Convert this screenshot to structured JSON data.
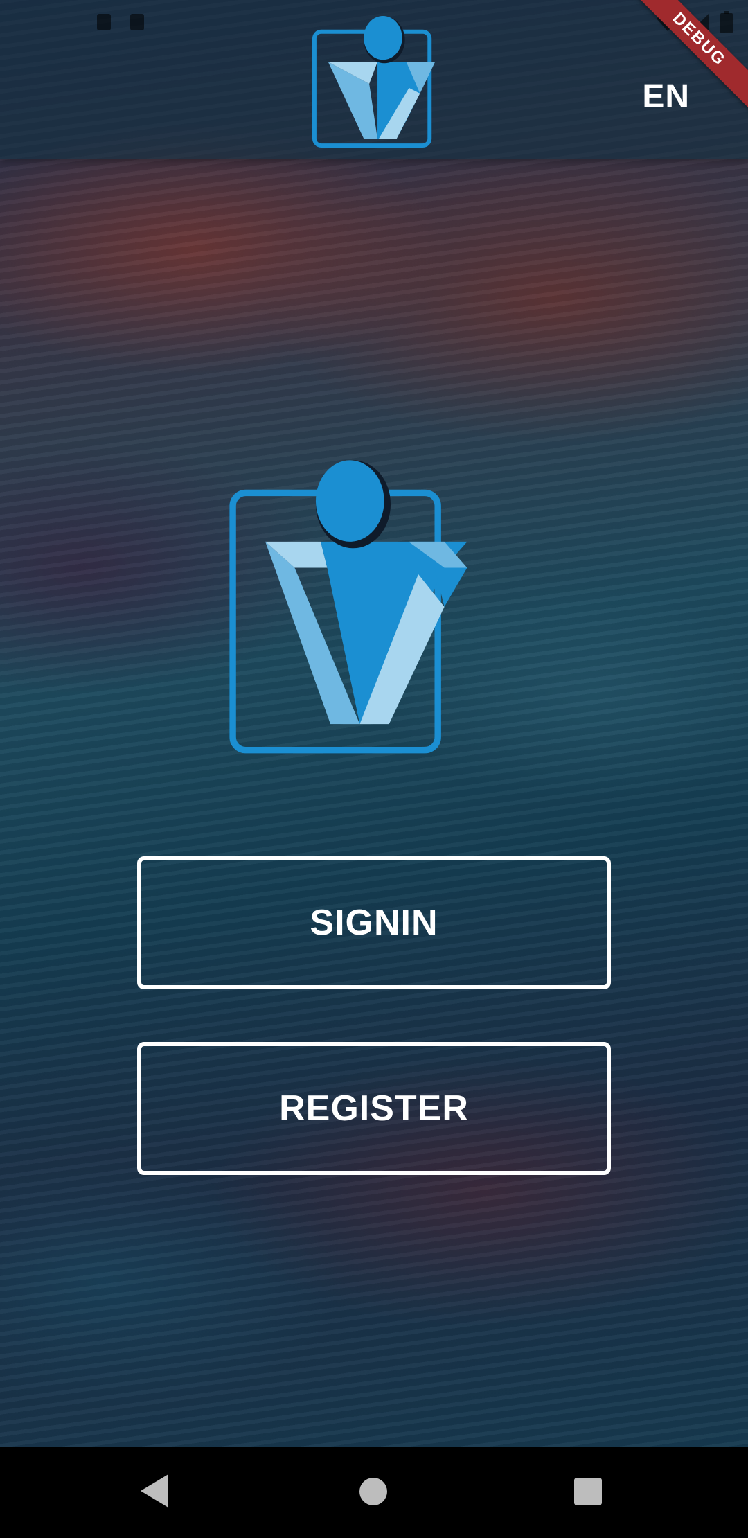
{
  "app_bar": {
    "language_label": "EN",
    "debug_label": "DEBUG",
    "logo_icon": "v-person-logo-icon"
  },
  "main": {
    "logo_icon": "v-person-logo-icon",
    "signin_label": "SIGNIN",
    "register_label": "REGISTER"
  },
  "nav_bar": {
    "back_icon": "back-triangle-icon",
    "home_icon": "home-circle-icon",
    "recent_icon": "recent-apps-square-icon"
  },
  "colors": {
    "logo_blue": "#1b8fd2",
    "logo_light": "#a8d6ef",
    "logo_mid": "#6fb8e2",
    "button_border": "#ffffff",
    "debug_ribbon": "#a02a2d"
  }
}
